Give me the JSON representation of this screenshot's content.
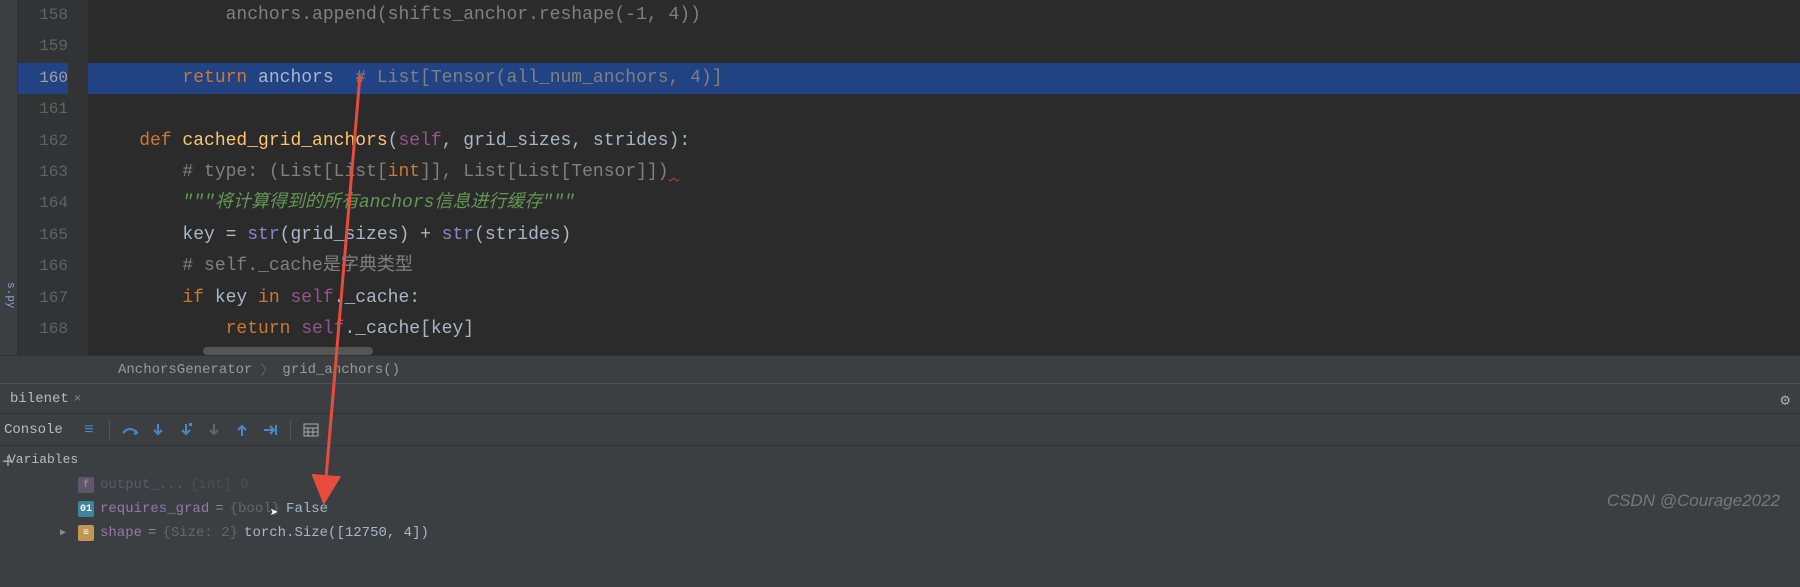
{
  "sidebar": {
    "file_label": "s.py"
  },
  "gutter": {
    "lines": [
      "158",
      "159",
      "160",
      "161",
      "162",
      "163",
      "164",
      "165",
      "166",
      "167",
      "168"
    ]
  },
  "code": {
    "line158": {
      "text": "            anchors.append(shifts_anchor.reshape(-1, 4))"
    },
    "line160": {
      "return_kw": "return",
      "var": " anchors",
      "comment": "  # List[Tensor(all_num_anchors, 4)]"
    },
    "line162": {
      "def_kw": "    def ",
      "func": "cached_grid_anchors",
      "params": "(self, grid_sizes, strides):"
    },
    "line163": {
      "comment_pre": "        # type: (",
      "list1": "List",
      "bracket1": "[",
      "list2": "List",
      "bracket2": "[",
      "int_kw": "int",
      "close1": "]], ",
      "list3": "List",
      "bracket3": "[",
      "list4": "List",
      "bracket4": "[Tensor]])"
    },
    "line164": {
      "docstring": "        \"\"\"将计算得到的所有anchors信息进行缓存\"\"\""
    },
    "line165": {
      "text1": "        key = ",
      "str1": "str",
      "text2": "(grid_sizes) + ",
      "str2": "str",
      "text3": "(strides)"
    },
    "line166": {
      "comment": "        # self._cache是字典类型"
    },
    "line167": {
      "if_kw": "        if ",
      "text1": "key ",
      "in_kw": "in ",
      "self_kw": "self",
      "text2": "._cache:"
    },
    "line168": {
      "return_kw": "            return ",
      "self_kw": "self",
      "text": "._cache[key]"
    }
  },
  "breadcrumb": {
    "item1": "AnchorsGenerator",
    "item2": "grid_anchors()"
  },
  "debug_tab": {
    "label": "bilenet"
  },
  "debug_toolbar": {
    "console_label": "Console"
  },
  "variables_panel": {
    "header": "Variables"
  },
  "variables": {
    "row0": {
      "name": "output_...",
      "eq": " = ",
      "value": "{int} 0"
    },
    "row1": {
      "name": "requires_grad",
      "eq": " = ",
      "type": "{bool} ",
      "value": "False"
    },
    "row2": {
      "name": "shape",
      "eq": " = ",
      "type": "{Size: 2} ",
      "value": "torch.Size([12750, 4])"
    }
  },
  "watermark": "CSDN @Courage2022"
}
